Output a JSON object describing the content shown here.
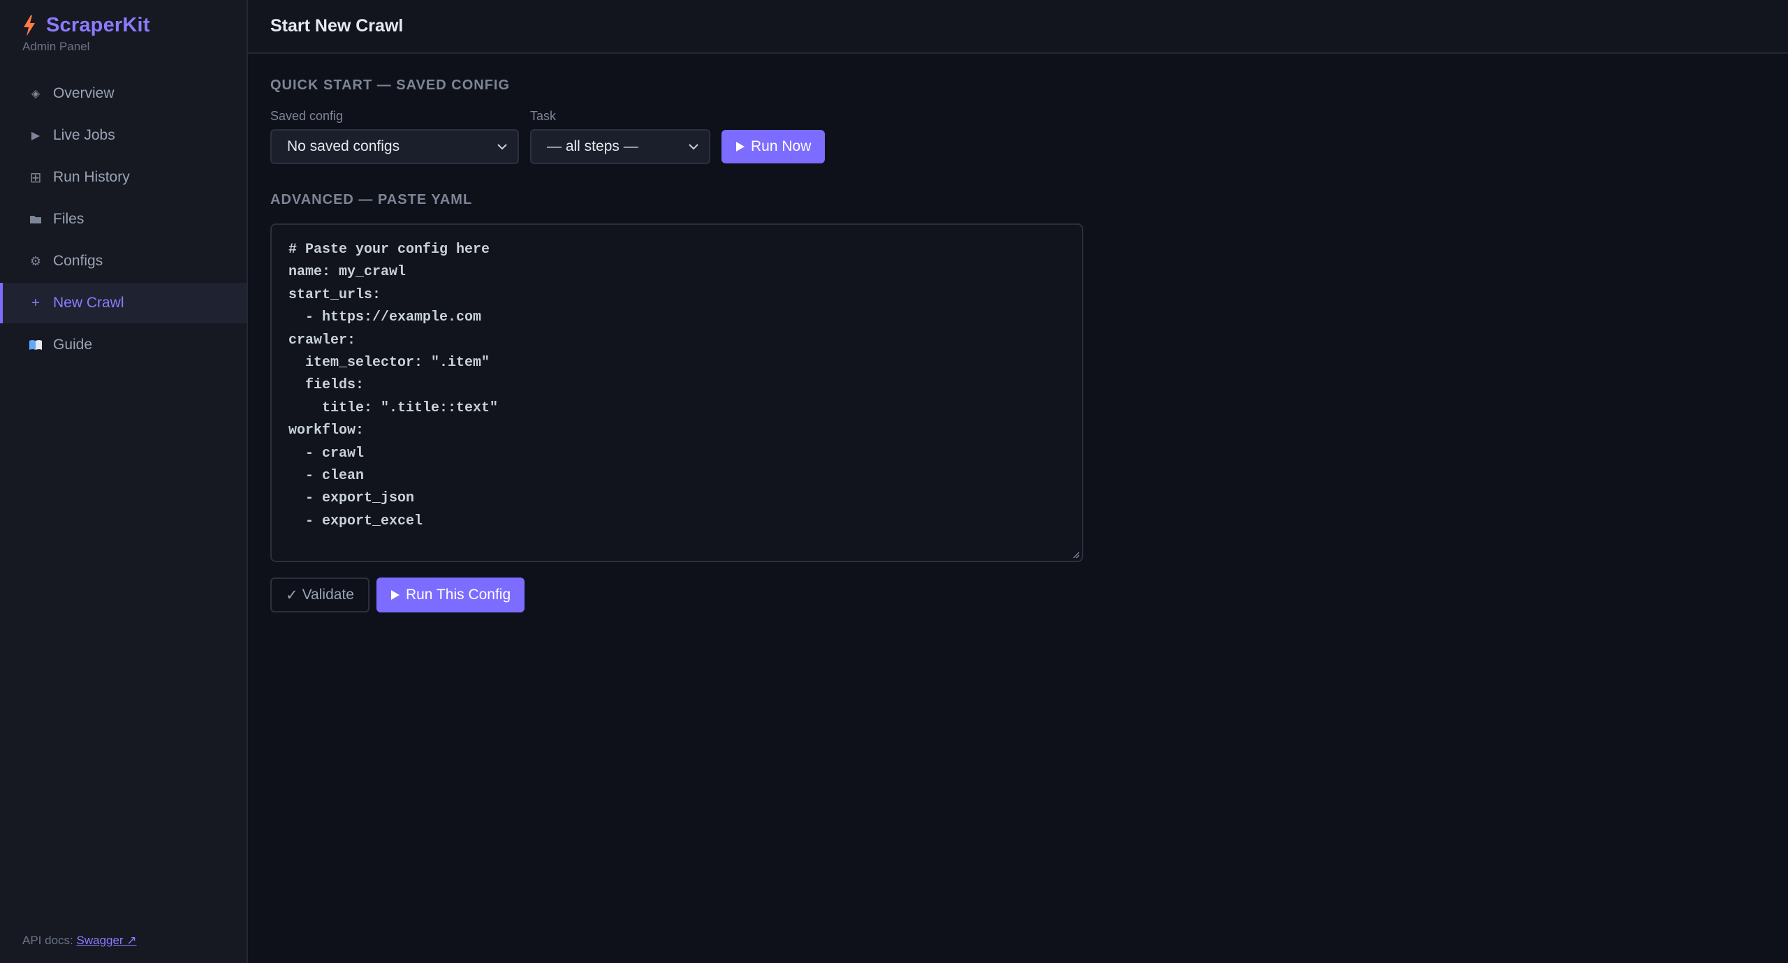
{
  "brand": {
    "name": "ScraperKit",
    "subtitle": "Admin Panel",
    "icon": "lightning-bolt-icon",
    "accent": "#8b7bff"
  },
  "sidebar": {
    "items": [
      {
        "label": "Overview",
        "icon": "diamond-icon",
        "glyph": "◈",
        "active": false
      },
      {
        "label": "Live Jobs",
        "icon": "play-icon",
        "glyph": "▶",
        "active": false
      },
      {
        "label": "Run History",
        "icon": "grid-icon",
        "glyph": "⊞",
        "active": false
      },
      {
        "label": "Files",
        "icon": "folder-icon",
        "glyph": "■",
        "active": false
      },
      {
        "label": "Configs",
        "icon": "gear-icon",
        "glyph": "⚙",
        "active": false
      },
      {
        "label": "New Crawl",
        "icon": "plus-icon",
        "glyph": "+",
        "active": true
      },
      {
        "label": "Guide",
        "icon": "book-icon",
        "glyph": "📖",
        "active": false
      }
    ],
    "api_docs_label": "API docs:",
    "api_docs_link": "Swagger ↗"
  },
  "header": {
    "title": "Start New Crawl"
  },
  "quick_start": {
    "title": "QUICK START — SAVED CONFIG",
    "saved_config_label": "Saved config",
    "saved_config_value": "No saved configs",
    "task_label": "Task",
    "task_value": "— all steps —",
    "run_now_label": "Run Now"
  },
  "advanced": {
    "title": "ADVANCED — PASTE YAML",
    "yaml": "# Paste your config here\nname: my_crawl\nstart_urls:\n  - https://example.com\ncrawler:\n  item_selector: \".item\"\n  fields:\n    title: \".title::text\"\nworkflow:\n  - crawl\n  - clean\n  - export_json\n  - export_excel",
    "validate_label": "Validate",
    "run_config_label": "Run This Config"
  }
}
